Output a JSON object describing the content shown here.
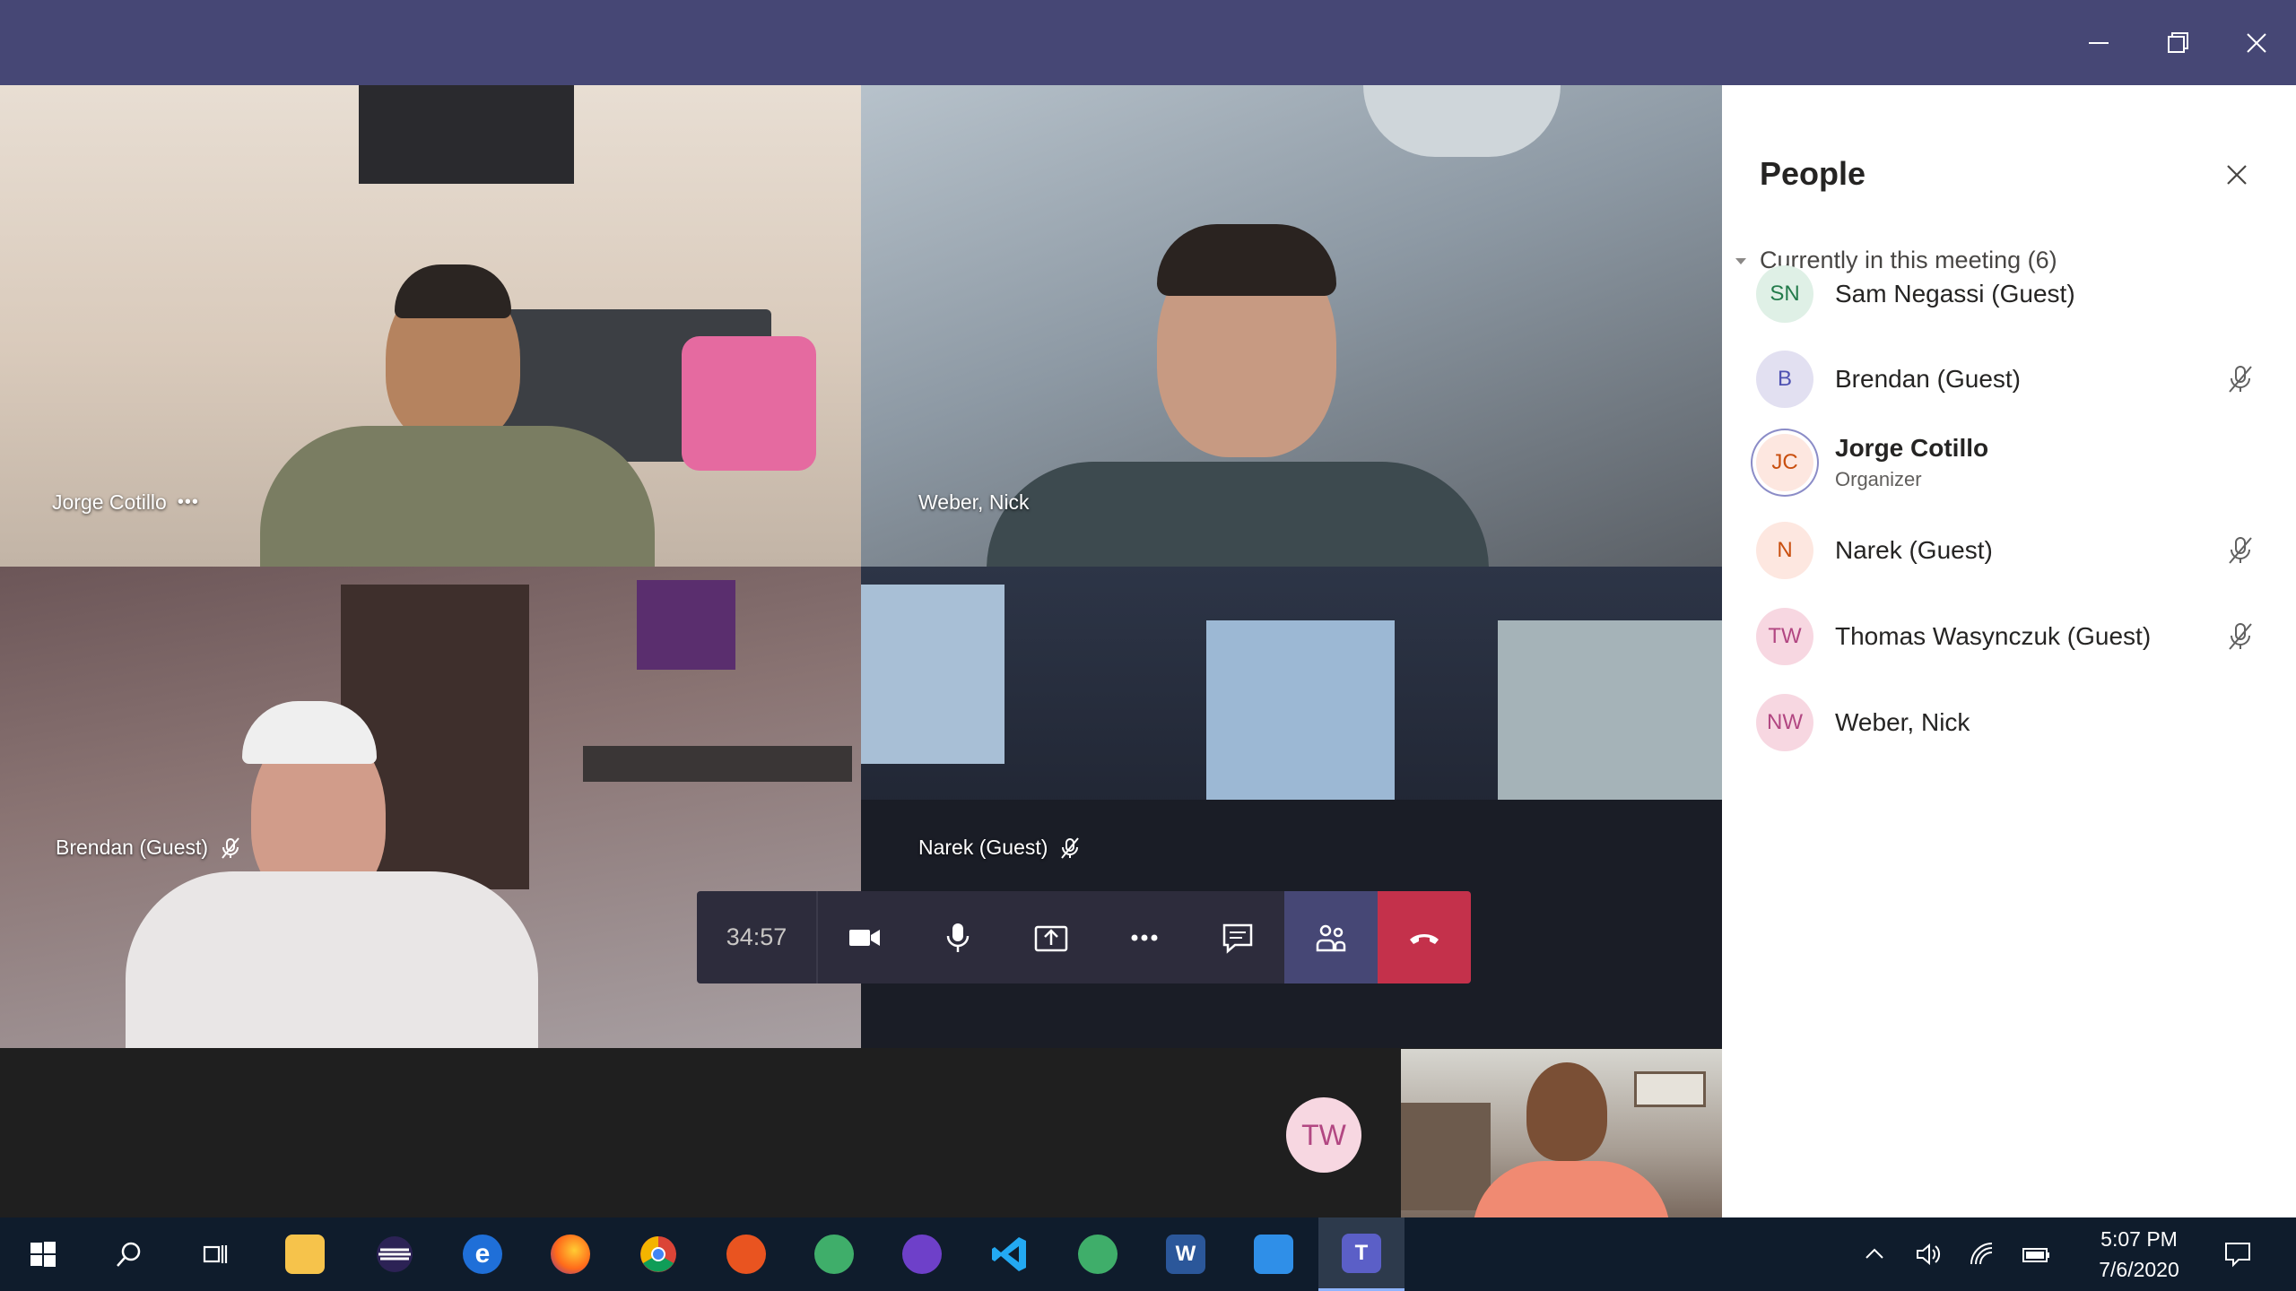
{
  "window": {
    "controls": [
      "minimize",
      "maximize",
      "close"
    ]
  },
  "tiles": [
    {
      "name": "Jorge Cotillo",
      "muted": false,
      "more": "•••"
    },
    {
      "name": "Weber, Nick",
      "muted": false
    },
    {
      "name": "Brendan (Guest)",
      "muted": true
    },
    {
      "name": "Narek (Guest)",
      "muted": true
    }
  ],
  "call": {
    "duration": "34:57",
    "controls": [
      "camera-icon",
      "mic-icon",
      "share-icon",
      "more-icon",
      "chat-icon",
      "people-icon",
      "hangup-icon"
    ]
  },
  "self": {
    "initials": "TW"
  },
  "people_panel": {
    "title": "People",
    "section": "Currently in this meeting (6)",
    "participants": [
      {
        "initials": "SN",
        "name": "Sam Negassi (Guest)",
        "role": "",
        "muted": false,
        "avatar_bg": "#dff0e6",
        "avatar_fg": "#237b4b"
      },
      {
        "initials": "B",
        "name": "Brendan (Guest)",
        "role": "",
        "muted": true,
        "avatar_bg": "#e2e0f1",
        "avatar_fg": "#4f52b2"
      },
      {
        "initials": "JC",
        "name": "Jorge Cotillo",
        "role": "Organizer",
        "muted": false,
        "avatar_bg": "#fde7e0",
        "avatar_fg": "#c94f0f"
      },
      {
        "initials": "N",
        "name": "Narek (Guest)",
        "role": "",
        "muted": true,
        "avatar_bg": "#fde7e0",
        "avatar_fg": "#c94f0f"
      },
      {
        "initials": "TW",
        "name": "Thomas Wasynczuk (Guest)",
        "role": "",
        "muted": true,
        "avatar_bg": "#f7d7e1",
        "avatar_fg": "#b24782"
      },
      {
        "initials": "NW",
        "name": "Weber, Nick",
        "role": "",
        "muted": false,
        "avatar_bg": "#f7d7e1",
        "avatar_fg": "#b24782"
      }
    ]
  },
  "taskbar": {
    "apps": [
      "start",
      "search",
      "task-view",
      "file-explorer",
      "eclipse",
      "edge",
      "firefox",
      "chrome",
      "ubuntu",
      "atom",
      "github-desktop",
      "vscode",
      "atom-beta",
      "word",
      "camera",
      "teams"
    ],
    "active_app": "teams",
    "word_label": "W",
    "teams_label": "T",
    "time": "5:07 PM",
    "date": "7/6/2020"
  },
  "colors": {
    "titlebar": "#464775",
    "hangup": "#c4314b",
    "panel_bg": "#ffffff",
    "taskbar": "#0f1c2c"
  }
}
